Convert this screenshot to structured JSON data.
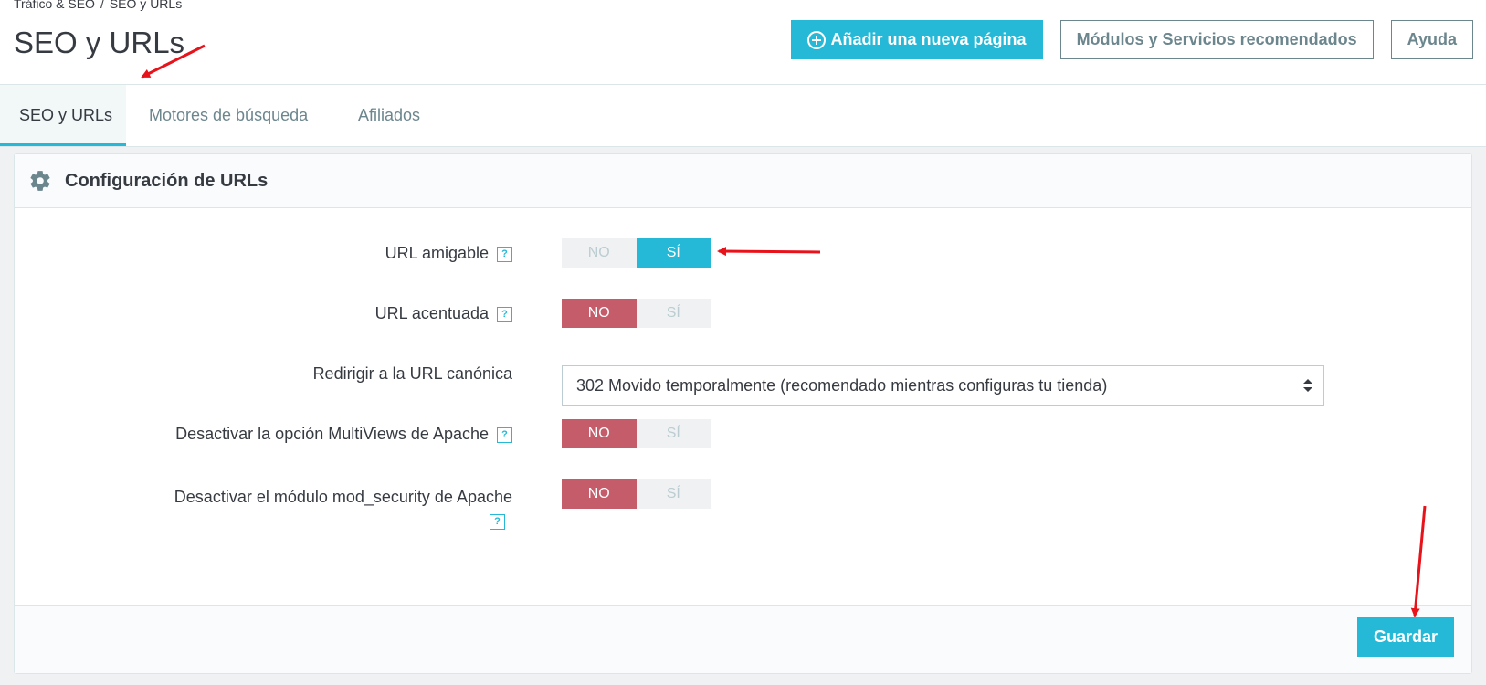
{
  "header": {
    "breadcrumb": [
      "Tráfico & SEO",
      "SEO y URLs"
    ],
    "title": "SEO y URLs",
    "buttons": {
      "add_page": "Añadir una nueva página",
      "modules": "Módulos y Servicios recomendados",
      "help": "Ayuda"
    }
  },
  "tabs": [
    {
      "label": "SEO y URLs",
      "active": true
    },
    {
      "label": "Motores de búsqueda",
      "active": false
    },
    {
      "label": "Afiliados",
      "active": false
    }
  ],
  "panel": {
    "title": "Configuración de URLs",
    "fields": [
      {
        "label": "URL amigable",
        "type": "switch",
        "value": "SÍ",
        "no_label": "NO",
        "yes_label": "SÍ",
        "help": "?"
      },
      {
        "label": "URL acentuada",
        "type": "switch",
        "value": "NO",
        "no_label": "NO",
        "yes_label": "SÍ",
        "help": "?"
      },
      {
        "label": "Redirigir a la URL canónica",
        "type": "select",
        "value": "302 Movido temporalmente (recomendado mientras configuras tu tienda)"
      },
      {
        "label": "Desactivar la opción MultiViews de Apache",
        "type": "switch",
        "value": "NO",
        "no_label": "NO",
        "yes_label": "SÍ",
        "help": "?"
      },
      {
        "label": "Desactivar el módulo mod_security de Apache",
        "type": "switch",
        "value": "NO",
        "no_label": "NO",
        "yes_label": "SÍ",
        "help": "?"
      }
    ],
    "save_label": "Guardar"
  },
  "colors": {
    "accent": "#25b9d7",
    "danger": "#c45c6a",
    "annotation_arrow": "#e8121b"
  },
  "icons": [
    "plus-circle-icon",
    "gear-icon",
    "help-icon",
    "sort-arrows-icon",
    "annotation-arrow"
  ]
}
